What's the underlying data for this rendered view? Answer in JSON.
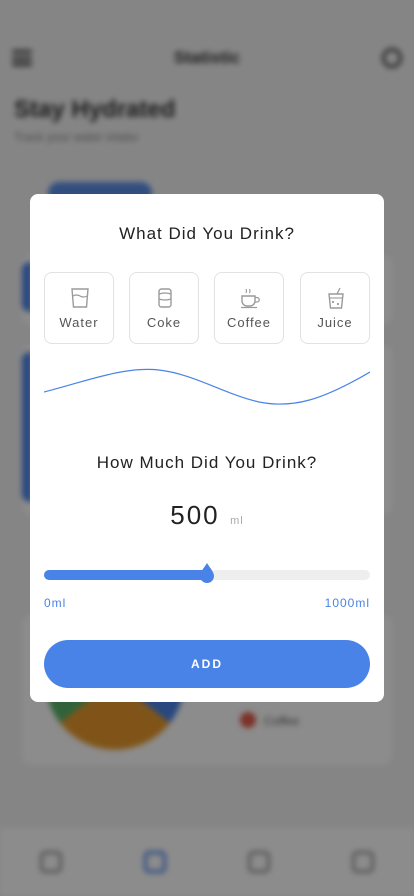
{
  "background": {
    "title": "Statistic",
    "heading": "Stay Hydrated",
    "subheading": "Track your water intake",
    "legend_label": "Coffee"
  },
  "modal": {
    "title": "What Did You Drink?",
    "drinks": [
      {
        "label": "Water",
        "icon": "glass-icon"
      },
      {
        "label": "Coke",
        "icon": "can-icon"
      },
      {
        "label": "Coffee",
        "icon": "cup-icon"
      },
      {
        "label": "Juice",
        "icon": "juice-icon"
      }
    ],
    "amount_title": "How Much Did You Drink?",
    "amount": {
      "value": "500",
      "unit": "ml"
    },
    "slider": {
      "min_label": "0ml",
      "max_label": "1000ml",
      "min": 0,
      "max": 1000,
      "value": 500
    },
    "add_label": "ADD"
  },
  "colors": {
    "accent": "#4a83e8",
    "track": "#eeeeee",
    "overlay": "rgba(0,0,0,0.45)"
  }
}
